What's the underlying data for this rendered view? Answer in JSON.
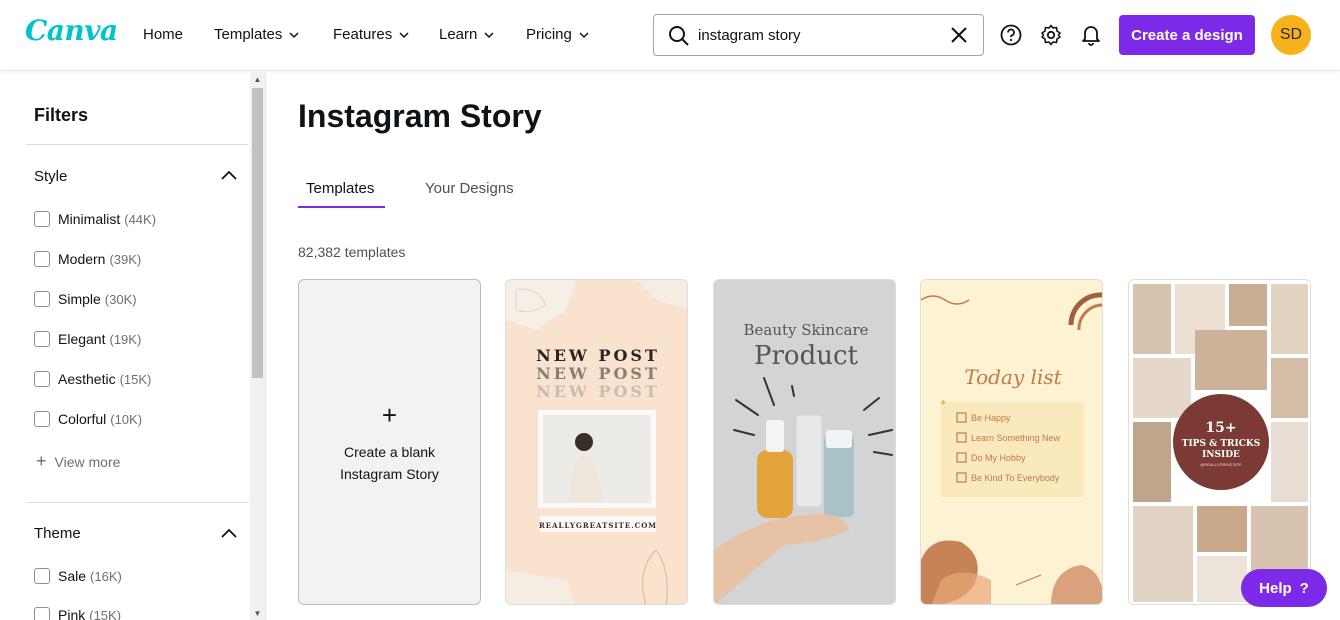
{
  "header": {
    "logo": "Canva",
    "nav": [
      {
        "label": "Home"
      },
      {
        "label": "Templates"
      },
      {
        "label": "Features"
      },
      {
        "label": "Learn"
      },
      {
        "label": "Pricing"
      }
    ],
    "search": {
      "value": "instagram story"
    },
    "create_label": "Create a design",
    "avatar_initials": "SD"
  },
  "sidebar": {
    "title": "Filters",
    "style": {
      "title": "Style",
      "options": [
        {
          "label": "Minimalist",
          "count": "(44K)"
        },
        {
          "label": "Modern",
          "count": "(39K)"
        },
        {
          "label": "Simple",
          "count": "(30K)"
        },
        {
          "label": "Elegant",
          "count": "(19K)"
        },
        {
          "label": "Aesthetic",
          "count": "(15K)"
        },
        {
          "label": "Colorful",
          "count": "(10K)"
        }
      ],
      "view_more": "View more"
    },
    "theme": {
      "title": "Theme",
      "options": [
        {
          "label": "Sale",
          "count": "(16K)"
        },
        {
          "label": "Pink",
          "count": "(15K)"
        }
      ]
    }
  },
  "main": {
    "title": "Instagram Story",
    "tabs": [
      {
        "label": "Templates"
      },
      {
        "label": "Your Designs"
      }
    ],
    "count_label": "82,382 templates",
    "blank_card_label": "Create a blank Instagram Story",
    "cards": [
      {
        "lines": [
          "NEW POST",
          "NEW POST",
          "NEW POST"
        ],
        "footer": "REALLYGREATSITE.COM"
      },
      {
        "line1": "Beauty Skincare",
        "line2": "Product"
      },
      {
        "title": "Today list",
        "items": [
          "Be Happy",
          "Learn Something New",
          "Do My Hobby",
          "Be Kind To Everybody"
        ]
      },
      {
        "big": "15+",
        "line1": "TIPS & TRICKS",
        "line2": "INSIDE",
        "small": "@REALLYGREATSITE"
      }
    ]
  },
  "help_label": "Help",
  "colors": {
    "accent": "#7d2ae8",
    "logo": "#00c4cc",
    "avatar": "#f5b21b"
  }
}
